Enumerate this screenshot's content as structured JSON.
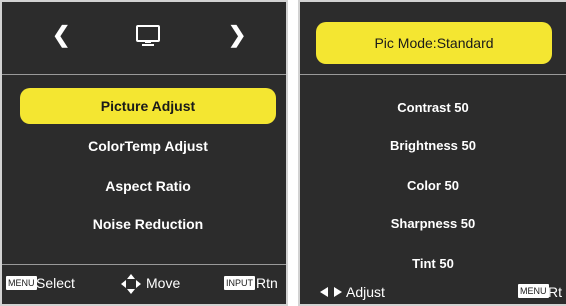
{
  "left_panel": {
    "nav": {
      "prev_icon": "chevron-left-icon",
      "monitor_icon": "monitor-icon",
      "next_icon": "chevron-right-icon"
    },
    "items": [
      {
        "label": "Picture Adjust"
      },
      {
        "label": "ColorTemp Adjust"
      },
      {
        "label": "Aspect Ratio"
      },
      {
        "label": "Noise Reduction"
      }
    ],
    "footer": {
      "menu_key": "MENU",
      "select_label": "Select",
      "move_label": "Move",
      "input_key": "INPUT",
      "return_label": "Rtn"
    }
  },
  "right_panel": {
    "mode_label": "Pic Mode:Standard",
    "values": [
      {
        "label": "Contrast 50"
      },
      {
        "label": "Brightness 50"
      },
      {
        "label": "Color 50"
      },
      {
        "label": "Sharpness 50"
      },
      {
        "label": "Tint 50"
      }
    ],
    "footer": {
      "adjust_label": "Adjust",
      "menu_key": "MENU",
      "return_label": "Rt"
    }
  },
  "colors": {
    "accent": "#f4e631",
    "panel_bg": "#2c2c2c"
  }
}
